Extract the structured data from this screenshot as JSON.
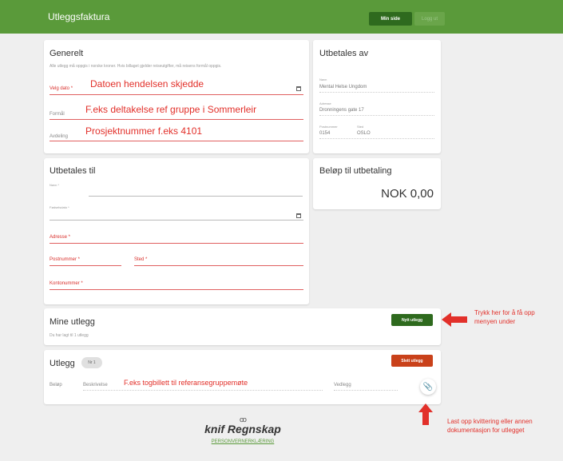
{
  "header": {
    "title": "Utleggsfaktura",
    "my_page": "Min side",
    "logout": "Logg ut"
  },
  "general": {
    "title": "Generelt",
    "note": "Alle utlegg må oppgis i norske kroner. Hvis billaget gjelder reiseutgifter, må reisens formål oppgis.",
    "date_label": "Velg dato *",
    "date_anno": "Datoen hendelsen skjedde",
    "purpose_label": "Formål",
    "purpose_anno": "F.eks deltakelse ref gruppe i Sommerleir",
    "dept_label": "Avdeling",
    "dept_anno": "Prosjektnummer f.eks 4101"
  },
  "payer": {
    "title": "Utbetales av",
    "name_label": "Navn",
    "name_value": "Mental Helse Ungdom",
    "addr_label": "Adresse",
    "addr_value": "Dronningens gate 17",
    "zip_label": "Postnummer",
    "zip_value": "0154",
    "city_label": "Sted",
    "city_value": "OSLO"
  },
  "payee": {
    "title": "Utbetales til",
    "name_label": "Navn *",
    "birth_label": "Fødselsdato *",
    "address_label": "Adresse *",
    "zip_label": "Postnummer *",
    "city_label": "Sted *",
    "account_label": "Kontonummer *"
  },
  "amount": {
    "title": "Beløp til utbetaling",
    "value": "NOK 0,00"
  },
  "my_expenses": {
    "title": "Mine utlegg",
    "subtitle": "Du har lagt til 1 utlegg",
    "new_button": "Nytt utlegg"
  },
  "expense": {
    "title": "Utlegg",
    "number": "Nr 1",
    "delete_button": "Slett utlegg",
    "amount_label": "Beløp",
    "desc_label": "Beskrivelse",
    "desc_anno": "F.eks togbillett til referansegruppemøte",
    "attach_label": "Vedlegg"
  },
  "annotations": {
    "new_hint": "Trykk her for å få opp menyen under",
    "upload_hint": "Last opp kvittering eller annen dokumentasjon for utlegget"
  },
  "footer": {
    "brand": "knif Regnskap",
    "link": "PERSONVERNERKLÆRING"
  },
  "colors": {
    "green": "#5a9a3a",
    "dark_green": "#2e6a1e",
    "red": "#e2302a"
  }
}
